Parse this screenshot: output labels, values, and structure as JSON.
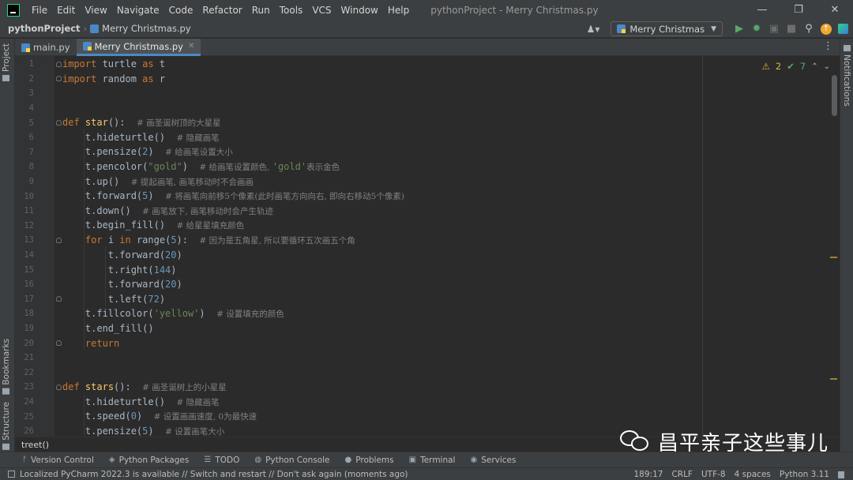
{
  "window": {
    "menu": [
      "File",
      "Edit",
      "View",
      "Navigate",
      "Code",
      "Refactor",
      "Run",
      "Tools",
      "VCS",
      "Window",
      "Help"
    ],
    "title": "pythonProject - Merry Christmas.py",
    "controls": {
      "minimize": "—",
      "maximize": "❐",
      "close": "✕"
    }
  },
  "navbar": {
    "project": "pythonProject",
    "separator": "›",
    "file": "Merry Christmas.py",
    "run_config": "Merry Christmas",
    "icons": {
      "user": "user-icon",
      "run": "run-icon",
      "debug": "debug-icon",
      "coverage": "coverage-icon",
      "stop": "stop-icon",
      "search": "search-icon",
      "update": "update-icon",
      "logo": "jetbrains-icon"
    }
  },
  "left_strip": {
    "project": "Project",
    "bookmarks": "Bookmarks",
    "structure": "Structure"
  },
  "right_strip": {
    "notifications": "Notifications"
  },
  "tabs": [
    {
      "label": "main.py",
      "active": false
    },
    {
      "label": "Merry Christmas.py",
      "active": true
    }
  ],
  "tabs_more": "⋮",
  "inspection": {
    "warnings": "2",
    "checks": "7"
  },
  "code_lines": [
    {
      "n": "1",
      "html": "<span class='kw'>import</span> turtle <span class='kw'>as</span> t"
    },
    {
      "n": "2",
      "html": "<span class='kw'>import</span> random <span class='kw'>as</span> r"
    },
    {
      "n": "3",
      "html": ""
    },
    {
      "n": "4",
      "html": ""
    },
    {
      "n": "5",
      "html": "<span class='kw'>def</span> <span class='fn'>star</span>():  <span class='cmt'># 画圣诞树顶的大星星</span>"
    },
    {
      "n": "6",
      "html": "    t.hideturtle()  <span class='cmt'># 隐藏画笔</span>"
    },
    {
      "n": "7",
      "html": "    t.pensize(<span class='num'>2</span>)  <span class='cmt'># 给画笔设置大小</span>"
    },
    {
      "n": "8",
      "html": "    t.pencolor(<span class='str'>\"gold\"</span>)  <span class='cmt'># 给画笔设置颜色, </span><span class='str'>'gold'</span><span class='cmt'>表示金色</span>"
    },
    {
      "n": "9",
      "html": "    t.up()  <span class='cmt'># 提起画笔, 画笔移动时不会画画</span>"
    },
    {
      "n": "10",
      "html": "    t.forward(<span class='num'>5</span>)  <span class='cmt'># 将画笔向前移5个像素(此时画笔方向向右, 即向右移动5个像素)</span>"
    },
    {
      "n": "11",
      "html": "    t.down()  <span class='cmt'># 画笔放下, 画笔移动时会产生轨迹</span>"
    },
    {
      "n": "12",
      "html": "    t.begin_fill()  <span class='cmt'># 给星星填充颜色</span>"
    },
    {
      "n": "13",
      "html": "    <span class='kw'>for</span> i <span class='kw'>in</span> range(<span class='num'>5</span>):  <span class='cmt'># 因为是五角星, 所以要循环五次画五个角</span>"
    },
    {
      "n": "14",
      "html": "        t.forward(<span class='num'>20</span>)"
    },
    {
      "n": "15",
      "html": "        t.right(<span class='num'>144</span>)"
    },
    {
      "n": "16",
      "html": "        t.forward(<span class='num'>20</span>)"
    },
    {
      "n": "17",
      "html": "        t.left(<span class='num'>72</span>)"
    },
    {
      "n": "18",
      "html": "    t.fillcolor(<span class='str'>'yellow'</span>)  <span class='cmt'># 设置填充的颜色</span>"
    },
    {
      "n": "19",
      "html": "    t.end_fill()"
    },
    {
      "n": "20",
      "html": "    <span class='kw'>return</span>"
    },
    {
      "n": "21",
      "html": ""
    },
    {
      "n": "22",
      "html": ""
    },
    {
      "n": "23",
      "html": "<span class='kw'>def</span> <span class='fn'>stars</span>():  <span class='cmt'># 画圣诞树上的小星星</span>"
    },
    {
      "n": "24",
      "html": "    t.hideturtle()  <span class='cmt'># 隐藏画笔</span>"
    },
    {
      "n": "25",
      "html": "    t.speed(<span class='num'>0</span>)  <span class='cmt'># 设置画画速度, 0为最快速</span>"
    },
    {
      "n": "26",
      "html": "    t.pensize(<span class='num'>5</span>)  <span class='cmt'># 设置画笔大小</span>"
    }
  ],
  "editor_breadcrumb": "treet()",
  "watermark": "昌平亲子这些事儿",
  "tool_windows": [
    {
      "label": "Version Control",
      "icon": "version-control-icon",
      "glyph": "ᚠ"
    },
    {
      "label": "Python Packages",
      "icon": "packages-icon",
      "glyph": "◈"
    },
    {
      "label": "TODO",
      "icon": "todo-icon",
      "glyph": "☰"
    },
    {
      "label": "Python Console",
      "icon": "python-console-icon",
      "glyph": "◍"
    },
    {
      "label": "Problems",
      "icon": "problems-icon",
      "glyph": "●"
    },
    {
      "label": "Terminal",
      "icon": "terminal-icon",
      "glyph": "▣"
    },
    {
      "label": "Services",
      "icon": "services-icon",
      "glyph": "◉"
    }
  ],
  "status": {
    "message": "Localized PyCharm 2022.3 is available // Switch and restart // Don't ask again (moments ago)",
    "position": "189:17",
    "line_ending": "CRLF",
    "encoding": "UTF-8",
    "indent": "4 spaces",
    "interpreter": "Python 3.11"
  }
}
